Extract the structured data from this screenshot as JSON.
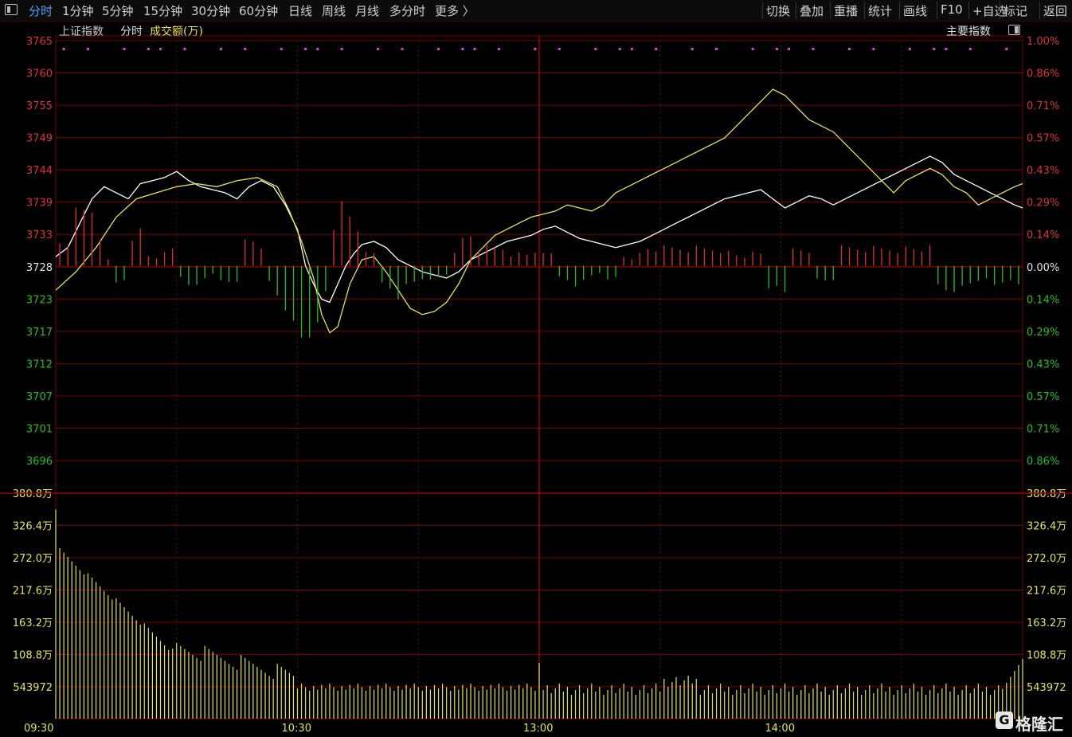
{
  "toolbar": {
    "left": [
      "分时",
      "1分钟",
      "5分钟",
      "15分钟",
      "30分钟",
      "60分钟",
      "日线",
      "周线",
      "月线",
      "多分时",
      "更多 〉"
    ],
    "right": [
      "切换",
      "叠加",
      "重播",
      "统计",
      "画线",
      "F10",
      "+自选",
      "标记",
      "返回"
    ],
    "active_index": 0
  },
  "header": {
    "index_name": "上证指数",
    "mode": "分时",
    "volume_label": "成交额(万)",
    "right_label": "主要指数"
  },
  "logo": {
    "text": "格隆汇",
    "glyph": "G"
  },
  "colors": {
    "grid": "#7a0000",
    "price_line": "#ffffff",
    "avg_line": "#e6e64a",
    "up": "#e03030",
    "down": "#20c020",
    "volume": "#e6e64a",
    "marker": "#e040e0",
    "active_tab": "#4aa3ff"
  },
  "chart_data": {
    "type": "line",
    "price_axis": {
      "ticks": [
        "3765",
        "3760",
        "3755",
        "3749",
        "3744",
        "3739",
        "3733",
        "3728",
        "3723",
        "3717",
        "3712",
        "3707",
        "3701",
        "3696"
      ],
      "ylim": [
        3696,
        3765
      ],
      "base": 3728
    },
    "percent_axis": {
      "ticks": [
        "1.00%",
        "0.86%",
        "0.71%",
        "0.57%",
        "0.43%",
        "0.29%",
        "0.14%",
        "0.00%",
        "0.14%",
        "0.29%",
        "0.43%",
        "0.57%",
        "0.71%",
        "0.86%"
      ]
    },
    "volume_axis": {
      "ticks": [
        "380.8万",
        "326.4万",
        "272.0万",
        "217.6万",
        "163.2万",
        "108.8万",
        "543972"
      ]
    },
    "time_axis": {
      "ticks": [
        "09:30",
        "10:30",
        "13:00",
        "14:00"
      ],
      "minutes_total": 240
    },
    "series": [
      {
        "key": "price",
        "points": [
          [
            0,
            3729.5
          ],
          [
            3,
            3731
          ],
          [
            6,
            3735
          ],
          [
            9,
            3739
          ],
          [
            12,
            3741
          ],
          [
            15,
            3740
          ],
          [
            18,
            3739
          ],
          [
            21,
            3741.5
          ],
          [
            24,
            3742
          ],
          [
            27,
            3742.5
          ],
          [
            30,
            3743.5
          ],
          [
            33,
            3742
          ],
          [
            36,
            3741
          ],
          [
            39,
            3740.5
          ],
          [
            42,
            3740
          ],
          [
            45,
            3739
          ],
          [
            48,
            3741
          ],
          [
            51,
            3742
          ],
          [
            54,
            3741
          ],
          [
            57,
            3738
          ],
          [
            60,
            3734
          ],
          [
            62,
            3728
          ],
          [
            64,
            3725
          ],
          [
            66,
            3722.5
          ],
          [
            68,
            3722
          ],
          [
            70,
            3725
          ],
          [
            72,
            3728
          ],
          [
            74,
            3730
          ],
          [
            76,
            3731.5
          ],
          [
            79,
            3732
          ],
          [
            82,
            3731
          ],
          [
            85,
            3729
          ],
          [
            88,
            3728
          ],
          [
            91,
            3727
          ],
          [
            94,
            3726.5
          ],
          [
            97,
            3726
          ],
          [
            100,
            3727
          ],
          [
            103,
            3729
          ],
          [
            106,
            3730
          ],
          [
            109,
            3731
          ],
          [
            112,
            3732
          ],
          [
            115,
            3732.5
          ],
          [
            118,
            3733
          ],
          [
            121,
            3734
          ],
          [
            124,
            3734.5
          ],
          [
            127,
            3733.5
          ],
          [
            130,
            3732.5
          ],
          [
            133,
            3732
          ],
          [
            136,
            3731.5
          ],
          [
            139,
            3731
          ],
          [
            142,
            3731.5
          ],
          [
            145,
            3732
          ],
          [
            148,
            3733
          ],
          [
            151,
            3734
          ],
          [
            154,
            3735
          ],
          [
            157,
            3736
          ],
          [
            160,
            3737
          ],
          [
            163,
            3738
          ],
          [
            166,
            3739
          ],
          [
            169,
            3739.5
          ],
          [
            172,
            3740
          ],
          [
            175,
            3740.5
          ],
          [
            178,
            3739
          ],
          [
            181,
            3737.5
          ],
          [
            184,
            3738.5
          ],
          [
            187,
            3739.5
          ],
          [
            190,
            3739
          ],
          [
            193,
            3738
          ],
          [
            196,
            3739
          ],
          [
            199,
            3740
          ],
          [
            202,
            3741
          ],
          [
            205,
            3742
          ],
          [
            208,
            3743
          ],
          [
            211,
            3744
          ],
          [
            214,
            3745
          ],
          [
            217,
            3746
          ],
          [
            220,
            3745
          ],
          [
            223,
            3743
          ],
          [
            226,
            3742
          ],
          [
            229,
            3741
          ],
          [
            232,
            3740
          ],
          [
            235,
            3739
          ],
          [
            238,
            3738
          ],
          [
            240,
            3737.5
          ]
        ]
      },
      {
        "key": "average",
        "points": [
          [
            0,
            3724
          ],
          [
            5,
            3727
          ],
          [
            10,
            3731
          ],
          [
            15,
            3736
          ],
          [
            20,
            3739
          ],
          [
            25,
            3740
          ],
          [
            30,
            3741
          ],
          [
            35,
            3741.5
          ],
          [
            40,
            3741
          ],
          [
            45,
            3742
          ],
          [
            50,
            3742.5
          ],
          [
            55,
            3741
          ],
          [
            58,
            3737
          ],
          [
            61,
            3732
          ],
          [
            64,
            3726
          ],
          [
            66,
            3720
          ],
          [
            68,
            3717
          ],
          [
            70,
            3718
          ],
          [
            73,
            3725
          ],
          [
            76,
            3729
          ],
          [
            79,
            3729.5
          ],
          [
            82,
            3727
          ],
          [
            85,
            3724
          ],
          [
            88,
            3721
          ],
          [
            91,
            3720
          ],
          [
            94,
            3720.5
          ],
          [
            97,
            3722
          ],
          [
            100,
            3725
          ],
          [
            103,
            3729
          ],
          [
            106,
            3731
          ],
          [
            109,
            3733
          ],
          [
            112,
            3734
          ],
          [
            115,
            3735
          ],
          [
            118,
            3736
          ],
          [
            121,
            3736.5
          ],
          [
            124,
            3737
          ],
          [
            127,
            3738
          ],
          [
            130,
            3737.5
          ],
          [
            133,
            3737
          ],
          [
            136,
            3738
          ],
          [
            139,
            3740
          ],
          [
            142,
            3741
          ],
          [
            145,
            3742
          ],
          [
            148,
            3743
          ],
          [
            151,
            3744
          ],
          [
            154,
            3745
          ],
          [
            157,
            3746
          ],
          [
            160,
            3747
          ],
          [
            163,
            3748
          ],
          [
            166,
            3749
          ],
          [
            169,
            3751
          ],
          [
            172,
            3753
          ],
          [
            175,
            3755
          ],
          [
            178,
            3757
          ],
          [
            181,
            3756
          ],
          [
            184,
            3754
          ],
          [
            187,
            3752
          ],
          [
            190,
            3751
          ],
          [
            193,
            3750
          ],
          [
            196,
            3748
          ],
          [
            199,
            3746
          ],
          [
            202,
            3744
          ],
          [
            205,
            3742
          ],
          [
            208,
            3740
          ],
          [
            211,
            3742
          ],
          [
            214,
            3743
          ],
          [
            217,
            3744
          ],
          [
            220,
            3743
          ],
          [
            223,
            3741
          ],
          [
            226,
            3740
          ],
          [
            229,
            3738
          ],
          [
            232,
            3739
          ],
          [
            235,
            3740
          ],
          [
            238,
            3741
          ],
          [
            240,
            3741.5
          ]
        ]
      }
    ]
  }
}
